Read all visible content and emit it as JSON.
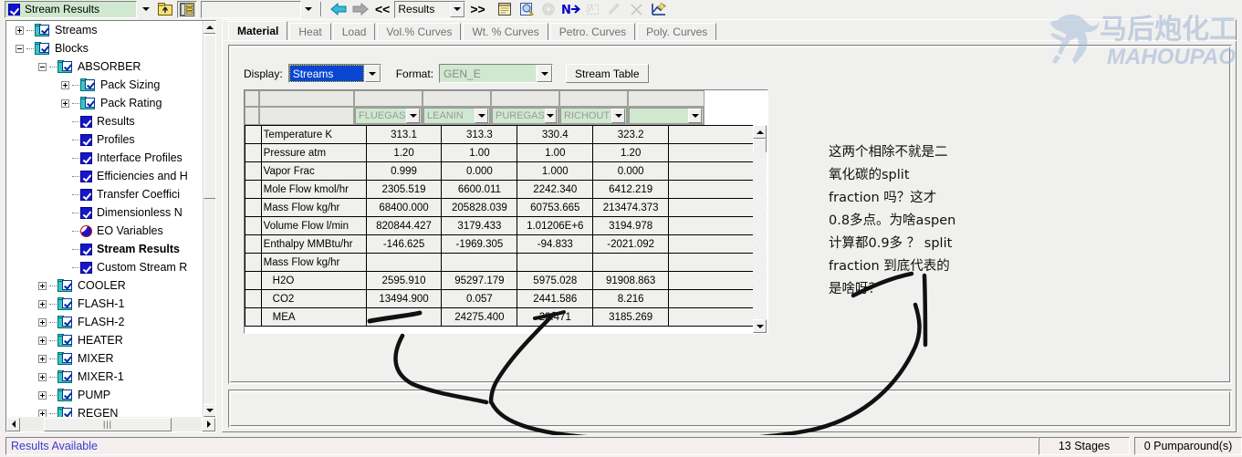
{
  "toolbar": {
    "object_selector": {
      "label": "Stream Results",
      "icon": "checked-square-icon"
    },
    "buttons": [
      {
        "name": "parent-folder-button",
        "icon": "folder-up-icon"
      },
      {
        "name": "tree-view-button",
        "icon": "tree-list-icon"
      }
    ],
    "blank_combo_value": "",
    "nav_back": "←",
    "nav_forward": "→",
    "prev_label": "<<",
    "results_combo": "Results",
    "next_label": ">>",
    "icon_buttons": [
      "notes-icon",
      "input-summary-icon",
      "report-icon",
      "next-input-icon",
      "selection-icon",
      "pencil-icon",
      "break-icon",
      "plot-wizard-icon"
    ]
  },
  "tree": {
    "items": [
      {
        "label": "Streams",
        "indent": 0,
        "expander": "plus",
        "icon": "folder-checked-icon",
        "bold": false
      },
      {
        "label": "Blocks",
        "indent": 0,
        "expander": "minus",
        "icon": "folder-checked-icon",
        "bold": false
      },
      {
        "label": "ABSORBER",
        "indent": 1,
        "expander": "minus",
        "icon": "folder-checked-icon",
        "bold": false
      },
      {
        "label": "Pack Sizing",
        "indent": 2,
        "expander": "plus",
        "icon": "folder-checked-icon",
        "bold": false
      },
      {
        "label": "Pack Rating",
        "indent": 2,
        "expander": "plus",
        "icon": "folder-checked-icon",
        "bold": false
      },
      {
        "label": "Results",
        "indent": 2,
        "expander": "none",
        "icon": "blue-check-icon",
        "bold": false
      },
      {
        "label": "Profiles",
        "indent": 2,
        "expander": "none",
        "icon": "blue-check-icon",
        "bold": false
      },
      {
        "label": "Interface Profiles",
        "indent": 2,
        "expander": "none",
        "icon": "blue-check-icon",
        "bold": false
      },
      {
        "label": "Efficiencies and H",
        "indent": 2,
        "expander": "none",
        "icon": "blue-check-icon",
        "bold": false
      },
      {
        "label": "Transfer Coeffici",
        "indent": 2,
        "expander": "none",
        "icon": "blue-check-icon",
        "bold": false
      },
      {
        "label": "Dimensionless N",
        "indent": 2,
        "expander": "none",
        "icon": "blue-check-icon",
        "bold": false
      },
      {
        "label": "EO Variables",
        "indent": 2,
        "expander": "none",
        "icon": "eo-variables-icon",
        "bold": false
      },
      {
        "label": "Stream Results",
        "indent": 2,
        "expander": "none",
        "icon": "blue-check-icon",
        "bold": true
      },
      {
        "label": "Custom Stream R",
        "indent": 2,
        "expander": "none",
        "icon": "blue-check-icon",
        "bold": false
      },
      {
        "label": "COOLER",
        "indent": 1,
        "expander": "plus",
        "icon": "folder-checked-icon",
        "bold": false
      },
      {
        "label": "FLASH-1",
        "indent": 1,
        "expander": "plus",
        "icon": "folder-checked-icon",
        "bold": false
      },
      {
        "label": "FLASH-2",
        "indent": 1,
        "expander": "plus",
        "icon": "folder-checked-icon",
        "bold": false
      },
      {
        "label": "HEATER",
        "indent": 1,
        "expander": "plus",
        "icon": "folder-checked-icon",
        "bold": false
      },
      {
        "label": "MIXER",
        "indent": 1,
        "expander": "plus",
        "icon": "folder-checked-icon",
        "bold": false
      },
      {
        "label": "MIXER-1",
        "indent": 1,
        "expander": "plus",
        "icon": "folder-checked-icon",
        "bold": false
      },
      {
        "label": "PUMP",
        "indent": 1,
        "expander": "plus",
        "icon": "folder-checked-icon",
        "bold": false
      },
      {
        "label": "REGEN",
        "indent": 1,
        "expander": "plus",
        "icon": "folder-checked-icon",
        "bold": false
      }
    ]
  },
  "tabs": [
    {
      "label": "Material",
      "active": true
    },
    {
      "label": "Heat",
      "active": false
    },
    {
      "label": "Load",
      "active": false
    },
    {
      "label": "Vol.% Curves",
      "active": false
    },
    {
      "label": "Wt. % Curves",
      "active": false
    },
    {
      "label": "Petro. Curves",
      "active": false
    },
    {
      "label": "Poly. Curves",
      "active": false
    }
  ],
  "controls": {
    "display_label": "Display:",
    "display_value": "Streams",
    "format_label": "Format:",
    "format_value": "GEN_E",
    "stream_table_button": "Stream Table"
  },
  "grid": {
    "stream_columns": [
      "FLUEGAS",
      "LEANIN",
      "PUREGAS",
      "RICHOUT",
      ""
    ],
    "rows": [
      {
        "label": "Temperature K",
        "indent": false,
        "values": [
          "313.1",
          "313.3",
          "330.4",
          "323.2",
          ""
        ]
      },
      {
        "label": "Pressure atm",
        "indent": false,
        "values": [
          "1.20",
          "1.00",
          "1.00",
          "1.20",
          ""
        ]
      },
      {
        "label": "Vapor Frac",
        "indent": false,
        "values": [
          "0.999",
          "0.000",
          "1.000",
          "0.000",
          ""
        ]
      },
      {
        "label": "Mole Flow kmol/hr",
        "indent": false,
        "values": [
          "2305.519",
          "6600.011",
          "2242.340",
          "6412.219",
          ""
        ]
      },
      {
        "label": "Mass Flow kg/hr",
        "indent": false,
        "values": [
          "68400.000",
          "205828.039",
          "60753.665",
          "213474.373",
          ""
        ]
      },
      {
        "label": "Volume Flow l/min",
        "indent": false,
        "values": [
          "820844.427",
          "3179.433",
          "1.01206E+6",
          "3194.978",
          ""
        ]
      },
      {
        "label": "Enthalpy   MMBtu/hr",
        "indent": false,
        "values": [
          "-146.625",
          "-1969.305",
          "-94.833",
          "-2021.092",
          ""
        ]
      },
      {
        "label": "Mass Flow kg/hr",
        "indent": false,
        "values": [
          "",
          "",
          "",
          "",
          ""
        ]
      },
      {
        "label": "H2O",
        "indent": true,
        "values": [
          "2595.910",
          "95297.179",
          "5975.028",
          "91908.863",
          ""
        ]
      },
      {
        "label": "CO2",
        "indent": true,
        "values": [
          "13494.900",
          "0.057",
          "2441.586",
          "8.216",
          ""
        ]
      },
      {
        "label": "MEA",
        "indent": true,
        "values": [
          "",
          "24275.400",
          "23.471",
          "3185.269",
          ""
        ]
      }
    ]
  },
  "annotation": {
    "lines": [
      "这两个相除不就是二",
      "氧化碳的split",
      "fraction 吗？这才",
      "0.8多点。为啥aspen",
      "计算都0.9多 ？ split",
      "fraction 到底代表的",
      "是啥呀？"
    ]
  },
  "watermark": {
    "chinese": "马后炮化工",
    "latin": "MAHOUPAO"
  },
  "statusbar": {
    "message": "Results Available",
    "stages": "13 Stages",
    "pumparounds": "0 Pumparound(s)"
  }
}
